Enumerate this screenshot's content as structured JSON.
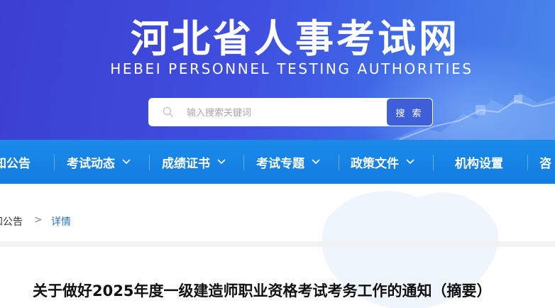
{
  "header": {
    "site_title": "河北省人事考试网",
    "site_subtitle": "HEBEI PERSONNEL TESTING AUTHORITIES",
    "brand_color": "#3f4fe0"
  },
  "search": {
    "placeholder": "输入搜索关键词",
    "value": "",
    "button_label": "搜 索",
    "icon": "search-icon"
  },
  "nav": {
    "items": [
      {
        "label": "知公告",
        "has_dropdown": false
      },
      {
        "label": "考试动态",
        "has_dropdown": true
      },
      {
        "label": "成绩证书",
        "has_dropdown": true
      },
      {
        "label": "考试专题",
        "has_dropdown": true
      },
      {
        "label": "政策文件",
        "has_dropdown": true
      },
      {
        "label": "机构设置",
        "has_dropdown": false
      },
      {
        "label": "咨",
        "has_dropdown": false
      }
    ],
    "bar_color": "#1a8ae8"
  },
  "breadcrumb": {
    "parent": "知公告",
    "separator": ">",
    "current": "详情"
  },
  "article": {
    "title": "关于做好2025年度一级建造师职业资格考试考务工作的通知（摘要）"
  }
}
